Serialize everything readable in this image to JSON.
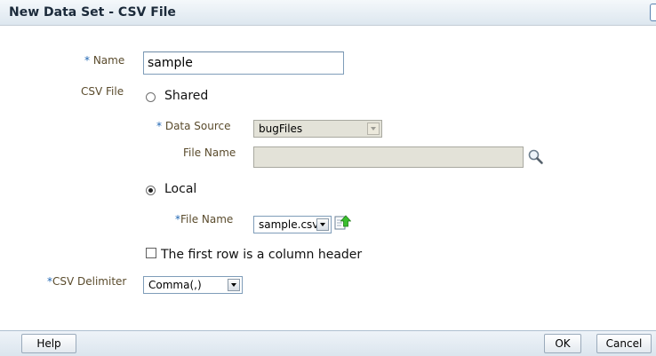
{
  "dialog": {
    "title": "New Data Set - CSV File"
  },
  "form": {
    "required_marker": "*",
    "name": {
      "label": "Name",
      "value": "sample"
    },
    "csv_file": {
      "label": "CSV File",
      "shared_option": {
        "label": "Shared",
        "selected": false,
        "data_source": {
          "label": "Data Source",
          "value": "bugFiles"
        },
        "file_name": {
          "label": "File Name",
          "value": ""
        }
      },
      "local_option": {
        "label": "Local",
        "selected": true,
        "file_name": {
          "label": "File Name",
          "value": "sample.csv"
        }
      }
    },
    "header_checkbox": {
      "label": "The first row is a column header",
      "checked": false
    },
    "delimiter": {
      "label": "CSV Delimiter",
      "value": "Comma(,)"
    }
  },
  "footer": {
    "help_label": "Help",
    "ok_label": "OK",
    "cancel_label": "Cancel"
  },
  "icons": {
    "search": "magnifier-icon",
    "upload": "upload-document-icon"
  },
  "colors": {
    "label": "#5a4b2c",
    "required": "#1f66b3",
    "title": "#1b2a3a"
  }
}
